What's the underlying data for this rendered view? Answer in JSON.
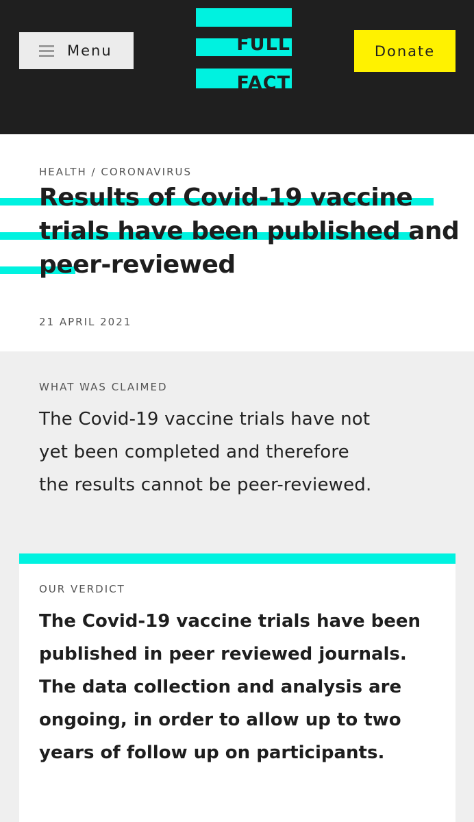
{
  "header": {
    "menu_label": "Menu",
    "logo_line1": "FULL",
    "logo_line2": "FACT",
    "donate_label": "Donate",
    "brand_color": "#00f2e0",
    "donate_color": "#fff200"
  },
  "article": {
    "breadcrumb": {
      "section": "HEALTH",
      "separator": " / ",
      "topic": "CORONAVIRUS"
    },
    "title": "Results of Covid-19 vaccine trials have been published and peer-reviewed",
    "date": "21 APRIL 2021"
  },
  "claim": {
    "label": "WHAT WAS CLAIMED",
    "text": "The Covid-19 vaccine trials have not yet been completed and therefore the results cannot be peer-reviewed."
  },
  "verdict": {
    "label": "OUR VERDICT",
    "text": "The Covid-19 vaccine trials have been published in peer reviewed journals. The data collection and analysis are ongoing, in order to allow up to two years of follow up on participants."
  },
  "icons": {
    "menu": "hamburger-icon"
  }
}
